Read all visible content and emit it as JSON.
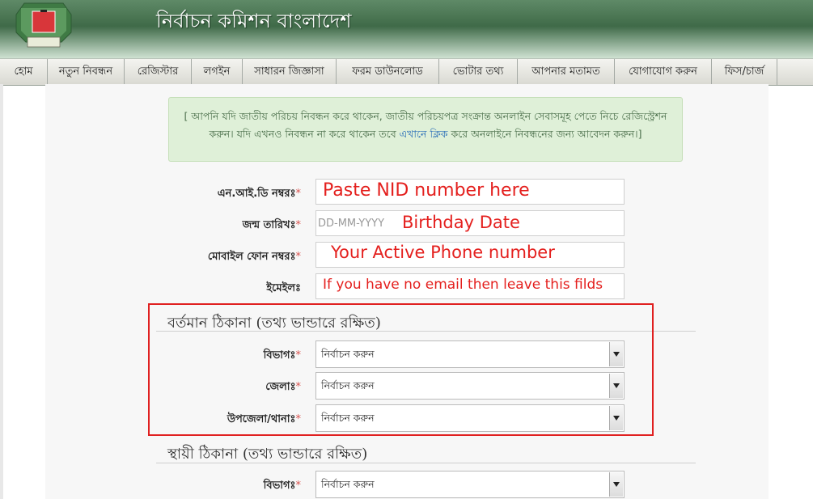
{
  "header": {
    "title": "নির্বাচন কমিশন বাংলাদেশ",
    "logo_caption": "বাংলাদেশ"
  },
  "nav": {
    "items": [
      "হোম",
      "নতুন নিবন্ধন",
      "রেজিস্টার",
      "লগইন",
      "সাধারন জিজ্ঞাসা",
      "ফরম ডাউনলোড",
      "ভোটার তথ্য",
      "আপনার মতামত",
      "যোগাযোগ করুন",
      "ফিস/চার্জ"
    ]
  },
  "notice": {
    "part1": "[ আপনি যদি জাতীয় পরিচয় নিবন্ধন করে থাকেন, জাতীয় পরিচয়পত্র সংক্রান্ত অনলাইন সেবাসমূহ পেতে নিচে রেজিস্ট্রেশন করুন। যদি এখনও নিবন্ধন না করে থাকেন তবে ",
    "link": "এখানে ক্লিক",
    "part2": " করে অনলাইনে নিবন্ধনের জন্য আবেদন করুন।]"
  },
  "form": {
    "nid_label": "এন.আই.ডি নম্বরঃ",
    "dob_label": "জন্ম তারিখঃ",
    "dob_placeholder": "DD-MM-YYYY",
    "mobile_label": "মোবাইল ফোন নম্বরঃ",
    "email_label": "ইমেইলঃ",
    "required_mark": "*"
  },
  "present_address": {
    "title": "বর্তমান ঠিকানা (তথ্য ভান্ডারে রক্ষিত)",
    "division_label": "বিভাগঃ",
    "district_label": "জেলাঃ",
    "upazila_label": "উপজেলা/থানাঃ",
    "select_value": "নির্বাচন করুন"
  },
  "permanent_address": {
    "title": "স্থায়ী ঠিকানা (তথ্য ভান্ডারে রক্ষিত)",
    "division_label": "বিভাগঃ",
    "select_value": "নির্বাচন করুন"
  },
  "annotations": {
    "nid": "Paste NID number here",
    "dob": "Birthday Date",
    "phone": "Your Active Phone number",
    "email": "If you have no email then leave this filds"
  },
  "colors": {
    "header": "#3f6a48",
    "annotation": "#e4201e",
    "notice_bg": "#dff0d8",
    "link": "#2a6eb8"
  }
}
